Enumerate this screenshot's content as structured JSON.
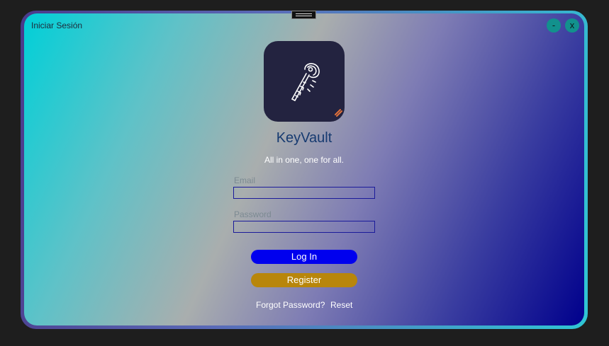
{
  "window": {
    "title": "Iniciar Sesión",
    "minimize_label": "-",
    "close_label": "x"
  },
  "app": {
    "name": "KeyVault",
    "tagline": "All in one, one for all.",
    "logo_icon": "key-icon"
  },
  "form": {
    "email_label": "Email",
    "email_value": "",
    "password_label": "Password",
    "password_value": ""
  },
  "buttons": {
    "login_label": "Log In",
    "register_label": "Register"
  },
  "links": {
    "forgot_password": "Forgot Password?",
    "reset": "Reset"
  },
  "colors": {
    "login_button": "#0000ee",
    "register_button": "#b8860b",
    "window_control": "#12918d",
    "logo_background": "#232340"
  }
}
